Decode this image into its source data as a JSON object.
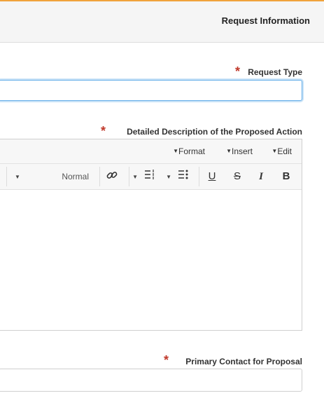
{
  "header": {
    "title": "Request Information"
  },
  "fields": {
    "request_type": {
      "label": "Request Type",
      "value": ""
    },
    "description": {
      "label": "Detailed Description of the Proposed Action",
      "value": ""
    },
    "primary_contact": {
      "label": "Primary Contact for Proposal",
      "value": ""
    }
  },
  "required_mark": "*",
  "editor": {
    "menu": {
      "edit": "Edit",
      "insert": "Insert",
      "format": "Format"
    },
    "toolbar": {
      "bold": "B",
      "italic": "I",
      "strike": "S",
      "underline": "U",
      "block_format": "Normal"
    }
  },
  "colors": {
    "accent": "#f0a23c",
    "required": "#c0392b",
    "focus": "#66afe9"
  }
}
